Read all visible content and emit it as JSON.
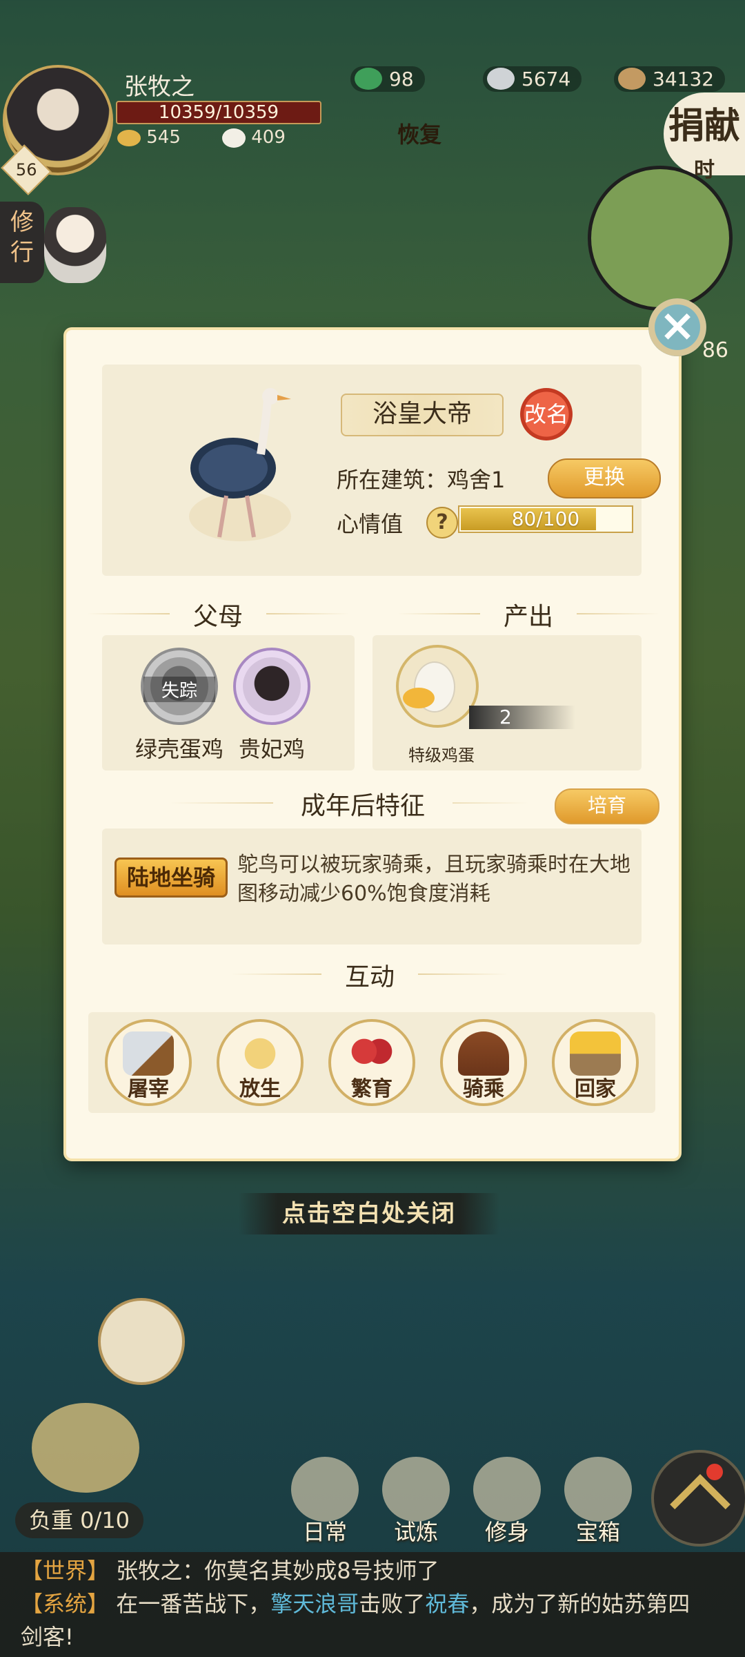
{
  "hud": {
    "player_name": "张牧之",
    "hp": "10359/10359",
    "level": "56",
    "stat_a": "545",
    "stat_b": "409",
    "currency_jade": "98",
    "currency_silver": "5674",
    "currency_copper": "34132",
    "restore_label": "恢复",
    "donate_label": "捐献",
    "donate_sub": "时",
    "side_tab": "修行",
    "side_value": "86"
  },
  "modal": {
    "animal_name": "浴皇大帝",
    "rename_label": "改名",
    "building_label": "所在建筑：鸡舍1",
    "change_label": "更换",
    "mood_label": "心情值",
    "mood_help": "?",
    "mood_colon": "：",
    "mood_value": "80/100",
    "mood_fraction": 0.8,
    "parents_title": "父母",
    "parent1_name": "绿壳蛋鸡",
    "parent1_status": "失踪",
    "parent2_name": "贵妃鸡",
    "output_title": "产出",
    "output_item": "特级鸡蛋",
    "output_count": "2",
    "traits_title": "成年后特征",
    "breed_label": "培育",
    "trait_badge": "陆地坐骑",
    "trait_desc": "鸵鸟可以被玩家骑乘，且玩家骑乘时在大地图移动减少60%饱食度消耗",
    "interact_title": "互动",
    "actions": [
      "屠宰",
      "放生",
      "繁育",
      "骑乘",
      "回家"
    ]
  },
  "close_hint": "点击空白处关闭",
  "bottom": {
    "load": "负重 0/10",
    "nav": [
      "日常",
      "试炼",
      "修身",
      "宝箱"
    ]
  },
  "chat": {
    "line1_tag": "【世界】",
    "line1_text": "张牧之：你莫名其妙成8号技师了",
    "line2_tag": "【系统】",
    "line2_pre": "在一番苦战下，",
    "line2_hl1": "擎天浪哥",
    "line2_mid": "击败了",
    "line2_hl2": "祝春",
    "line2_post": "，成为了新的姑苏第四",
    "line3": "剑客!"
  }
}
